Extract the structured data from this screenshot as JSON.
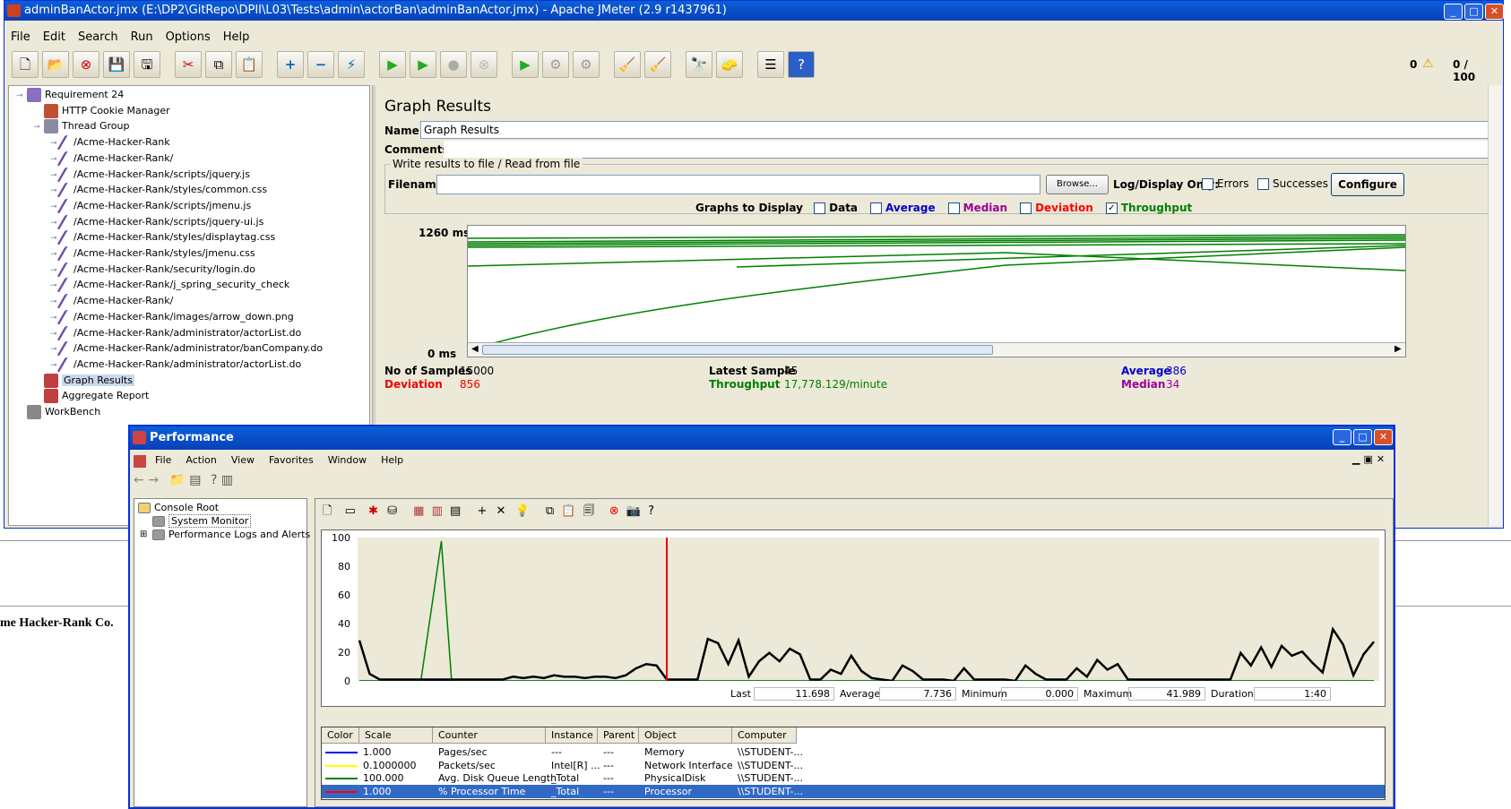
{
  "background": {
    "page_fragment": "me Hacker-Rank Co."
  },
  "jmeter": {
    "title": "adminBanActor.jmx (E:\\DP2\\GitRepo\\DPII\\L03\\Tests\\admin\\actorBan\\adminBanActor.jmx) - Apache JMeter (2.9 r1437961)",
    "menu": [
      "File",
      "Edit",
      "Search",
      "Run",
      "Options",
      "Help"
    ],
    "warnings": "0",
    "threads": "0 / 100",
    "tree": [
      {
        "label": "Requirement 24",
        "indent": 0,
        "icon": "flask-icon"
      },
      {
        "label": "HTTP Cookie Manager",
        "indent": 1,
        "icon": "cookie-icon"
      },
      {
        "label": "Thread Group",
        "indent": 1,
        "icon": "thread-group-icon"
      },
      {
        "label": "/Acme-Hacker-Rank",
        "indent": 2,
        "icon": "sampler-icon"
      },
      {
        "label": "/Acme-Hacker-Rank/",
        "indent": 2,
        "icon": "sampler-icon"
      },
      {
        "label": "/Acme-Hacker-Rank/scripts/jquery.js",
        "indent": 2,
        "icon": "sampler-icon"
      },
      {
        "label": "/Acme-Hacker-Rank/styles/common.css",
        "indent": 2,
        "icon": "sampler-icon"
      },
      {
        "label": "/Acme-Hacker-Rank/scripts/jmenu.js",
        "indent": 2,
        "icon": "sampler-icon"
      },
      {
        "label": "/Acme-Hacker-Rank/scripts/jquery-ui.js",
        "indent": 2,
        "icon": "sampler-icon"
      },
      {
        "label": "/Acme-Hacker-Rank/styles/displaytag.css",
        "indent": 2,
        "icon": "sampler-icon"
      },
      {
        "label": "/Acme-Hacker-Rank/styles/jmenu.css",
        "indent": 2,
        "icon": "sampler-icon"
      },
      {
        "label": "/Acme-Hacker-Rank/security/login.do",
        "indent": 2,
        "icon": "sampler-icon"
      },
      {
        "label": "/Acme-Hacker-Rank/j_spring_security_check",
        "indent": 2,
        "icon": "sampler-icon"
      },
      {
        "label": "/Acme-Hacker-Rank/",
        "indent": 2,
        "icon": "sampler-icon"
      },
      {
        "label": "/Acme-Hacker-Rank/images/arrow_down.png",
        "indent": 2,
        "icon": "sampler-icon"
      },
      {
        "label": "/Acme-Hacker-Rank/administrator/actorList.do",
        "indent": 2,
        "icon": "sampler-icon"
      },
      {
        "label": "/Acme-Hacker-Rank/administrator/banCompany.do",
        "indent": 2,
        "icon": "sampler-icon"
      },
      {
        "label": "/Acme-Hacker-Rank/administrator/actorList.do",
        "indent": 2,
        "icon": "sampler-icon"
      },
      {
        "label": "Graph Results",
        "indent": 1,
        "icon": "graph-icon",
        "selected": true
      },
      {
        "label": "Aggregate Report",
        "indent": 1,
        "icon": "report-icon"
      },
      {
        "label": "WorkBench",
        "indent": 0,
        "icon": "workbench-icon"
      }
    ],
    "panel": {
      "heading": "Graph Results",
      "name_label": "Name:",
      "name_value": "Graph Results",
      "comments_label": "Comments:",
      "file_group": "Write results to file / Read from file",
      "filename_label": "Filename",
      "browse_label": "Browse...",
      "log_display_label": "Log/Display Only:",
      "errors_label": "Errors",
      "successes_label": "Successes",
      "configure_label": "Configure",
      "graphs_label": "Graphs to Display",
      "checks": [
        {
          "label": "Data",
          "checked": false,
          "color": "#000000"
        },
        {
          "label": "Average",
          "checked": false,
          "color": "#0000cc"
        },
        {
          "label": "Median",
          "checked": false,
          "color": "#990099"
        },
        {
          "label": "Deviation",
          "checked": false,
          "color": "#ff0000"
        },
        {
          "label": "Throughput",
          "checked": true,
          "color": "#008000"
        }
      ],
      "ymax_label": "1260 ms",
      "ymin_label": "0 ms",
      "stats": {
        "samples_label": "No of Samples",
        "samples": "15000",
        "latest_label": "Latest Sample",
        "latest": "45",
        "average_label": "Average",
        "average": "386",
        "deviation_label": "Deviation",
        "deviation": "856",
        "throughput_label": "Throughput",
        "throughput": "17,778.129/minute",
        "median_label": "Median",
        "median": "34"
      }
    }
  },
  "perfmon": {
    "title": "Performance",
    "menu": [
      "File",
      "Action",
      "View",
      "Favorites",
      "Window",
      "Help"
    ],
    "tree": [
      {
        "label": "Console Root",
        "indent": 0,
        "icon": "folder-icon"
      },
      {
        "label": "System Monitor",
        "indent": 1,
        "icon": "monitor-icon",
        "selected": true
      },
      {
        "label": "Performance Logs and Alerts",
        "indent": 1,
        "icon": "logs-icon",
        "expander": "+"
      }
    ],
    "yticks": [
      "100",
      "80",
      "60",
      "40",
      "20",
      "0"
    ],
    "stats": {
      "last_label": "Last",
      "last": "11.698",
      "average_label": "Average",
      "average": "7.736",
      "minimum_label": "Minimum",
      "minimum": "0.000",
      "maximum_label": "Maximum",
      "maximum": "41.989",
      "duration_label": "Duration",
      "duration": "1:40"
    },
    "columns": [
      "Color",
      "Scale",
      "Counter",
      "Instance",
      "Parent",
      "Object",
      "Computer"
    ],
    "rows": [
      {
        "color": "#0000ff",
        "scale": "1.000",
        "counter": "Pages/sec",
        "instance": "---",
        "parent": "---",
        "object": "Memory",
        "computer": "\\\\STUDENT-..."
      },
      {
        "color": "#ffff00",
        "scale": "0.1000000",
        "counter": "Packets/sec",
        "instance": "Intel[R] ...",
        "parent": "---",
        "object": "Network Interface",
        "computer": "\\\\STUDENT-..."
      },
      {
        "color": "#008000",
        "scale": "100.000",
        "counter": "Avg. Disk Queue Length",
        "instance": "_Total",
        "parent": "---",
        "object": "PhysicalDisk",
        "computer": "\\\\STUDENT-..."
      },
      {
        "color": "#ff0000",
        "scale": "1.000",
        "counter": "% Processor Time",
        "instance": "_Total",
        "parent": "---",
        "object": "Processor",
        "computer": "\\\\STUDENT-...",
        "selected": true
      }
    ]
  },
  "chart_data": {
    "type": "line",
    "title": "",
    "ylim": [
      0,
      100
    ],
    "series": [
      {
        "name": "% Processor Time",
        "color": "#000000",
        "x": [
          0,
          1,
          2,
          3,
          4,
          5,
          6,
          7,
          8,
          9,
          10,
          11,
          12,
          13,
          14,
          15,
          16,
          17,
          18,
          19,
          20,
          21,
          22,
          23,
          24,
          25,
          26,
          27,
          28,
          29,
          30,
          31,
          32,
          33,
          34,
          35,
          36,
          37,
          38,
          39,
          40,
          41,
          42,
          43,
          44,
          45,
          46,
          47,
          48,
          49,
          50,
          51,
          52,
          53,
          54,
          55,
          56,
          57,
          58,
          59,
          60,
          61,
          62,
          63,
          64,
          65,
          66,
          67,
          68,
          69,
          70,
          71,
          72,
          73,
          74,
          75,
          76,
          77,
          78,
          79,
          80,
          81,
          82,
          83,
          84,
          85,
          86,
          87,
          88,
          89,
          90,
          91,
          92,
          93,
          94,
          95,
          96,
          97,
          98,
          99
        ],
        "values": [
          29,
          5,
          1,
          1,
          1,
          1,
          1,
          1,
          1,
          1,
          1,
          1,
          1,
          1,
          1,
          3,
          2,
          3,
          2,
          4,
          3,
          3,
          2,
          3,
          3,
          2,
          4,
          9,
          12,
          11,
          1,
          1,
          1,
          1,
          30,
          27,
          12,
          29,
          3,
          14,
          20,
          14,
          23,
          19,
          1,
          1,
          8,
          5,
          18,
          7,
          2,
          1,
          0,
          11,
          7,
          1,
          1,
          1,
          0,
          9,
          1,
          1,
          1,
          1,
          0,
          11,
          5,
          1,
          1,
          1,
          9,
          3,
          15,
          8,
          12,
          1,
          1,
          1,
          1,
          1,
          1,
          1,
          1,
          1,
          1,
          1,
          20,
          11,
          24,
          10,
          25,
          18,
          21,
          13,
          6,
          37,
          26,
          4,
          19,
          28
        ]
      },
      {
        "name": "Avg. Disk Queue Length",
        "color": "#008000",
        "x": [
          0,
          6,
          8,
          9,
          10,
          99
        ],
        "values": [
          0,
          0,
          100,
          0,
          0,
          0
        ]
      },
      {
        "name": "Pages/sec",
        "color": "#0000ff",
        "x": [
          0,
          99
        ],
        "values": [
          0,
          0
        ]
      },
      {
        "name": "Packets/sec",
        "color": "#ffff00",
        "x": [
          0,
          99
        ],
        "values": [
          0,
          0
        ]
      }
    ],
    "cursor_x": 30
  },
  "colors": {
    "xp_blue": "#0a5fd8",
    "selection": "#316ac5",
    "throughput": "#008000"
  }
}
